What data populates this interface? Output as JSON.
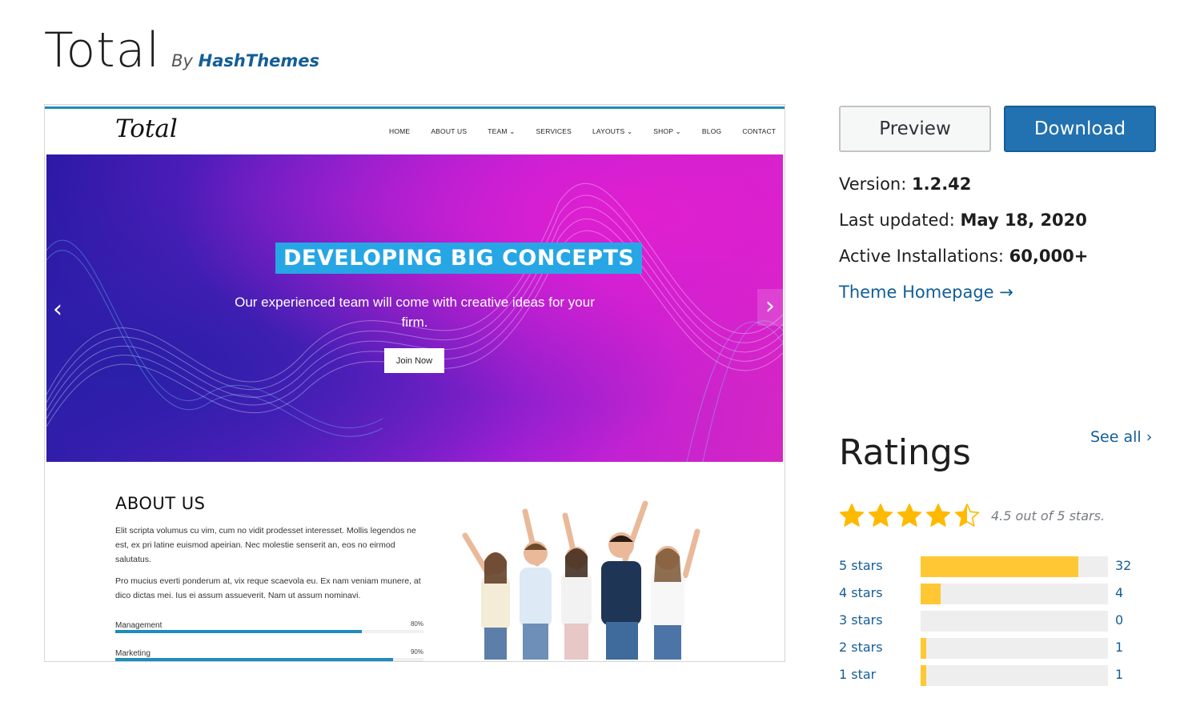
{
  "header": {
    "theme_name": "Total",
    "by": "By",
    "author": "HashThemes"
  },
  "screenshot": {
    "logo": "Total",
    "nav": [
      "HOME",
      "ABOUT US",
      "TEAM ⌄",
      "SERVICES",
      "LAYOUTS ⌄",
      "SHOP ⌄",
      "BLOG",
      "CONTACT"
    ],
    "hero": {
      "headline": "DEVELOPING BIG CONCEPTS",
      "subtext": "Our experienced team will come with creative ideas for your firm.",
      "button": "Join Now",
      "prev_arrow": "‹",
      "next_arrow": "›"
    },
    "about": {
      "title": "ABOUT US",
      "paragraph1": "Elit scripta volumus cu vim, cum no vidit prodesset interesset. Mollis legendos ne est, ex pri latine euismod apeirian. Nec molestie senserit an, eos no eirmod salutatus.",
      "paragraph2": "Pro mucius everti ponderum at, vix reque scaevola eu. Ex nam veniam munere, at dico dictas mei. Ius ei assum assueverit. Nam ut assum nominavi.",
      "skills": [
        {
          "label": "Management",
          "percent_text": "80%",
          "percent": 80
        },
        {
          "label": "Marketing",
          "percent_text": "90%",
          "percent": 90
        }
      ]
    }
  },
  "actions": {
    "preview": "Preview",
    "download": "Download"
  },
  "meta": {
    "version_label": "Version:",
    "version_value": "1.2.42",
    "updated_label": "Last updated:",
    "updated_value": "May 18, 2020",
    "installs_label": "Active Installations:",
    "installs_value": "60,000+",
    "homepage_link": "Theme Homepage →"
  },
  "ratings": {
    "title": "Ratings",
    "see_all": "See all ›",
    "stars_filled": 4.5,
    "summary": "4.5 out of 5 stars.",
    "star_color": "#ffb900",
    "bar_color": "#ffc733",
    "rows": [
      {
        "label": "5 stars",
        "count": "32",
        "fraction": 0.842
      },
      {
        "label": "4 stars",
        "count": "4",
        "fraction": 0.105
      },
      {
        "label": "3 stars",
        "count": "0",
        "fraction": 0
      },
      {
        "label": "2 stars",
        "count": "1",
        "fraction": 0.026
      },
      {
        "label": "1 star",
        "count": "1",
        "fraction": 0.026
      }
    ]
  },
  "colors": {
    "link": "#135e96",
    "download_bg": "#2271b1",
    "headline_bg": "#27a6e5"
  }
}
